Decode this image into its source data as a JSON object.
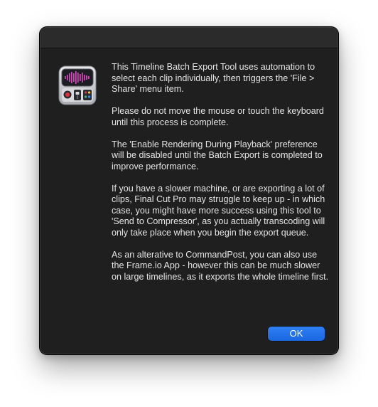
{
  "dialog": {
    "icon": "commandpost-app-icon",
    "paragraphs": [
      "This Timeline Batch Export Tool uses automation to select each clip individually, then triggers the 'File > Share' menu item.",
      "Please do not move the mouse or touch the keyboard until this process is complete.",
      "The 'Enable Rendering During Playback' preference will be disabled until the Batch Export is completed to improve performance.",
      "If you have a slower machine, or are exporting a lot of clips, Final Cut Pro may struggle to keep up - in which case, you might have more success using this tool to 'Send to Compressor', as you actually transcoding will only take place when you begin the export queue.",
      "As an alterative to CommandPost, you can also use the Frame.io App - however this can be much slower on large timelines, as it exports the whole timeline first."
    ],
    "ok_label": "OK"
  },
  "colors": {
    "window_background": "#1f1f1f",
    "text": "#e4e4e4",
    "accent": "#2a76f0"
  }
}
